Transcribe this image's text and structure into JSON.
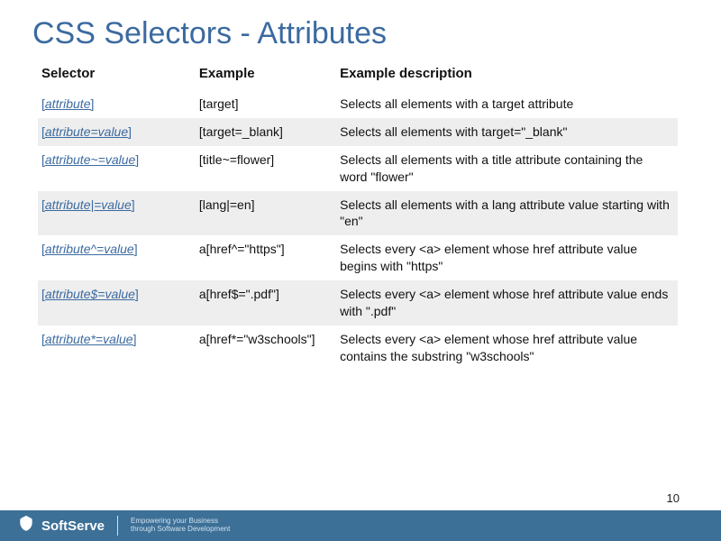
{
  "title": "CSS Selectors - Attributes",
  "columns": {
    "c1": "Selector",
    "c2": "Example",
    "c3": "Example description"
  },
  "rows": [
    {
      "selector_link": "attribute",
      "example": "[target]",
      "desc": "Selects all elements with a target attribute"
    },
    {
      "selector_link": "attribute=value",
      "example": "[target=_blank]",
      "desc": "Selects all elements with target=\"_blank\""
    },
    {
      "selector_link": "attribute~=value",
      "example": "[title~=flower]",
      "desc": "Selects all elements with a title attribute containing the word \"flower\""
    },
    {
      "selector_link": "attribute|=value",
      "example": "[lang|=en]",
      "desc": "Selects all elements with a lang attribute value starting with \"en\""
    },
    {
      "selector_link": "attribute^=value",
      "example": "a[href^=\"https\"]",
      "desc": "Selects every <a> element whose href attribute value begins with \"https\""
    },
    {
      "selector_link": "attribute$=value",
      "example": "a[href$=\".pdf\"]",
      "desc": "Selects every <a> element whose href attribute value ends with \".pdf\""
    },
    {
      "selector_link": "attribute*=value",
      "example": "a[href*=\"w3schools\"]",
      "desc": "Selects every <a> element whose href attribute value contains the substring \"w3schools\""
    }
  ],
  "bracket_open": "[",
  "bracket_close": "]",
  "footer": {
    "brand": "SoftServe",
    "tagline_l1": "Empowering your Business",
    "tagline_l2": "through Software Development"
  },
  "page_number": "10"
}
